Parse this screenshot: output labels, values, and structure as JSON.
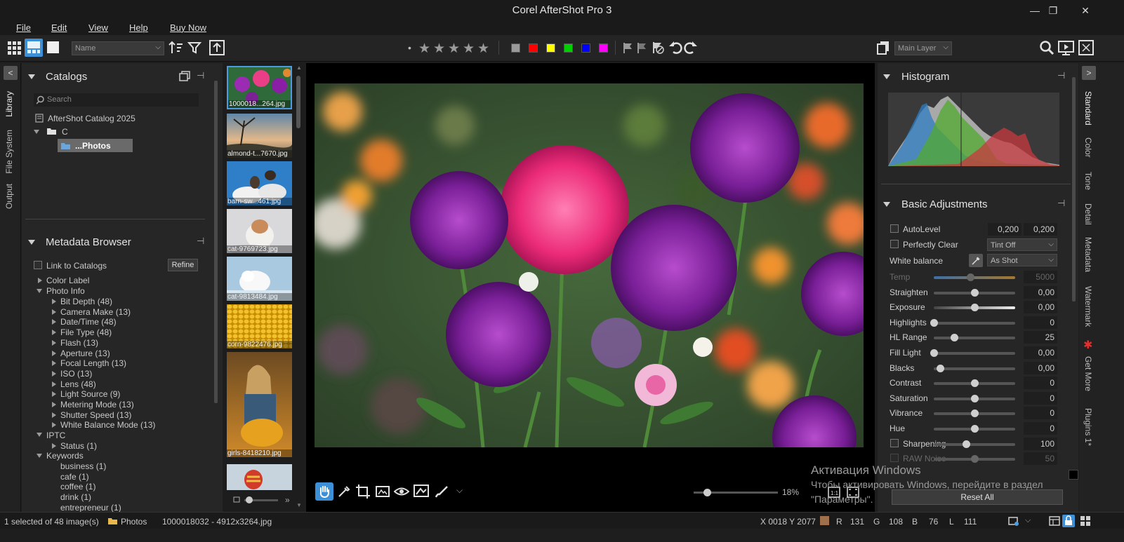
{
  "window": {
    "title": "Corel AfterShot Pro 3",
    "min_glyph": "—",
    "max_glyph": "❐",
    "close_glyph": "✕"
  },
  "menu": [
    "File",
    "Edit",
    "View",
    "Help",
    "Buy Now"
  ],
  "toolbar": {
    "sort_select": "Name",
    "layer_select": "Main Layer",
    "rating_dot": "•",
    "color_labels": [
      "#9a9a9a",
      "#ff0000",
      "#ffff00",
      "#00d000",
      "#0000ff",
      "#ff00ff"
    ]
  },
  "left_tabs": [
    "Library",
    "File System",
    "Output"
  ],
  "catalogs": {
    "title": "Catalogs",
    "search_placeholder": "Search",
    "catalog_name": "AfterShot Catalog 2025",
    "drive": "C",
    "selected_folder": "...Photos"
  },
  "metadata": {
    "title": "Metadata Browser",
    "link_label": "Link to Catalogs",
    "refine_label": "Refine",
    "color_label": "Color Label",
    "photo_info": "Photo Info",
    "photo_info_items": [
      "Bit Depth (48)",
      "Camera Make (13)",
      "Date/Time (48)",
      "File Type (48)",
      "Flash (13)",
      "Aperture (13)",
      "Focal Length (13)",
      "ISO (13)",
      "Lens (48)",
      "Light Source (9)",
      "Metering Mode (13)",
      "Shutter Speed (13)",
      "White Balance Mode (13)"
    ],
    "iptc": "IPTC",
    "iptc_items": [
      "Status (1)"
    ],
    "keywords": "Keywords",
    "keyword_items": [
      "business (1)",
      "cafe (1)",
      "coffee (1)",
      "drink (1)",
      "entrepreneur (1)"
    ]
  },
  "filmstrip": {
    "items": [
      {
        "caption": "1000018...264.jpg"
      },
      {
        "caption": "almond-t...7670.jpg"
      },
      {
        "caption": "barn-sw...461.jpg"
      },
      {
        "caption": "cat-9769723.jpg"
      },
      {
        "caption": "cat-9813484.jpg"
      },
      {
        "caption": "corn-9822476.jpg"
      },
      {
        "caption": "girls-8418210.jpg"
      },
      {
        "caption": ""
      }
    ],
    "more_glyph": "»"
  },
  "viewer": {
    "zoom": "18%",
    "zoom_value_fraction": 0.08
  },
  "histogram": {
    "title": "Histogram"
  },
  "basic": {
    "title": "Basic Adjustments",
    "autolevel": {
      "label": "AutoLevel",
      "v1": "0,200",
      "v2": "0,200"
    },
    "perfectly_clear": {
      "label": "Perfectly Clear",
      "option": "Tint Off"
    },
    "white_balance": {
      "label": "White balance",
      "option": "As Shot"
    },
    "sliders": [
      {
        "label": "Temp",
        "value": "5000",
        "pos": 0.45,
        "dim": true
      },
      {
        "label": "Straighten",
        "value": "0,00",
        "pos": 0.5
      },
      {
        "label": "Exposure",
        "value": "0,00",
        "pos": 0.5
      },
      {
        "label": "Highlights",
        "value": "0",
        "pos": 0.0
      },
      {
        "label": "HL Range",
        "value": "25",
        "pos": 0.25
      },
      {
        "label": "Fill Light",
        "value": "0,00",
        "pos": 0.0
      },
      {
        "label": "Blacks",
        "value": "0,00",
        "pos": 0.08
      },
      {
        "label": "Contrast",
        "value": "0",
        "pos": 0.5
      },
      {
        "label": "Saturation",
        "value": "0",
        "pos": 0.5
      },
      {
        "label": "Vibrance",
        "value": "0",
        "pos": 0.5
      },
      {
        "label": "Hue",
        "value": "0",
        "pos": 0.5
      },
      {
        "label": "Sharpening",
        "value": "100",
        "pos": 0.4
      },
      {
        "label": "RAW Noise",
        "value": "50",
        "pos": 0.5,
        "dim": true
      }
    ],
    "reset_label": "Reset All"
  },
  "right_tabs": [
    "Standard",
    "Color",
    "Tone",
    "Detail",
    "Metadata",
    "Watermark",
    "Get More",
    "Plugins 1*"
  ],
  "status": {
    "selection": "1 selected of 48 image(s)",
    "folder": "Photos",
    "file": "1000018032 - 4912x3264.jpg",
    "coords": "X 0018  Y 2077",
    "r_label": "R",
    "r_val": "131",
    "g_label": "G",
    "g_val": "108",
    "b_label": "B",
    "b_val": "76",
    "l_label": "L",
    "l_val": "111",
    "pixel_color": "#a0704c"
  },
  "watermark": {
    "line1": "Активация Windows",
    "line2": "Чтобы активировать Windows, перейдите в раздел",
    "line3": "\"Параметры\"."
  }
}
